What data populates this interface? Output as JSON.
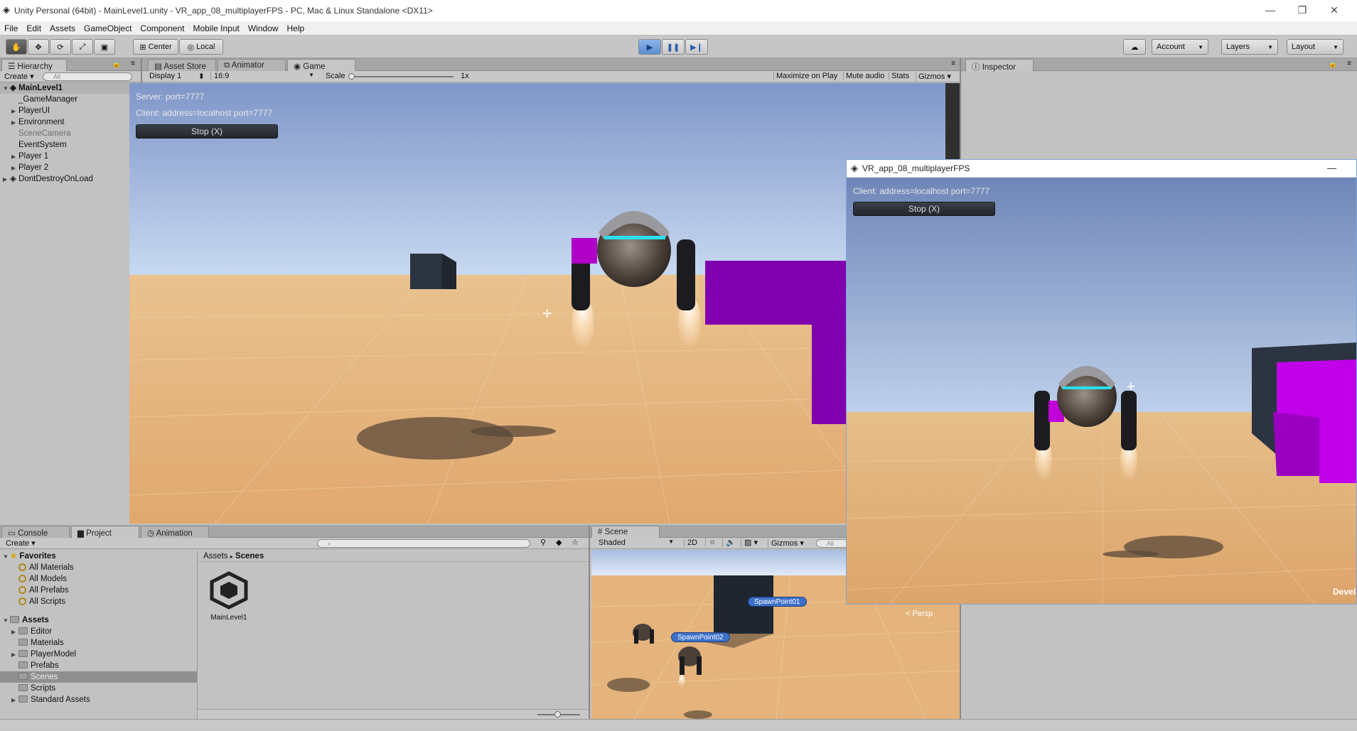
{
  "app": {
    "window_title": "Unity Personal (64bit) - MainLevel1.unity - VR_app_08_multiplayerFPS - PC, Mac & Linux Standalone <DX11>",
    "minimize": "—",
    "maximize": "❐",
    "close": "✕"
  },
  "menu": [
    "File",
    "Edit",
    "Assets",
    "GameObject",
    "Component",
    "Mobile Input",
    "Window",
    "Help"
  ],
  "toolbar": {
    "pivot": "Center",
    "space": "Local",
    "account": "Account",
    "layers": "Layers",
    "layout": "Layout"
  },
  "hierarchy": {
    "tab": "Hierarchy",
    "create": "Create",
    "search_placeholder": "All",
    "scene": "MainLevel1",
    "items": [
      {
        "label": "_GameManager",
        "expandable": false,
        "dim": false
      },
      {
        "label": "PlayerUI",
        "expandable": true,
        "dim": false
      },
      {
        "label": "Environment",
        "expandable": true,
        "dim": false
      },
      {
        "label": "SceneCamera",
        "expandable": false,
        "dim": true
      },
      {
        "label": "EventSystem",
        "expandable": false,
        "dim": false
      },
      {
        "label": "Player 1",
        "expandable": true,
        "dim": false
      },
      {
        "label": "Player 2",
        "expandable": true,
        "dim": false
      }
    ],
    "dont_destroy": "DontDestroyOnLoad"
  },
  "center_tabs": {
    "asset_store": "Asset Store",
    "animator": "Animator",
    "game": "Game"
  },
  "game_bar": {
    "display": "Display 1",
    "aspect": "16:9",
    "scale_label": "Scale",
    "scale_value": "1x",
    "maximize": "Maximize on Play",
    "mute": "Mute audio",
    "stats": "Stats",
    "gizmos": "Gizmos"
  },
  "game": {
    "server_text": "Server: port=7777",
    "client_text": "Client: address=localhost port=7777",
    "stop_button": "Stop (X)"
  },
  "inspector": {
    "tab": "Inspector"
  },
  "second_window": {
    "title": "VR_app_08_multiplayerFPS",
    "minimize": "—",
    "client_text": "Client: address=localhost port=7777",
    "stop_button": "Stop (X)",
    "watermark": "Devel"
  },
  "bottom_tabs": {
    "console": "Console",
    "project": "Project",
    "animation": "Animation"
  },
  "project": {
    "create": "Create",
    "favorites": "Favorites",
    "favorite_items": [
      "All Materials",
      "All Models",
      "All Prefabs",
      "All Scripts"
    ],
    "assets": "Assets",
    "asset_folders": [
      {
        "label": "Editor",
        "expandable": true,
        "selected": false
      },
      {
        "label": "Materials",
        "expandable": false,
        "selected": false
      },
      {
        "label": "PlayerModel",
        "expandable": true,
        "selected": false
      },
      {
        "label": "Prefabs",
        "expandable": false,
        "selected": false
      },
      {
        "label": "Scenes",
        "expandable": false,
        "selected": true
      },
      {
        "label": "Scripts",
        "expandable": false,
        "selected": false
      },
      {
        "label": "Standard Assets",
        "expandable": true,
        "selected": false
      }
    ],
    "breadcrumb_root": "Assets",
    "breadcrumb_current": "Scenes",
    "asset_name": "MainLevel1"
  },
  "scene_panel": {
    "tab": "Scene",
    "shading": "Shaded",
    "mode_2d": "2D",
    "gizmos": "Gizmos",
    "search": "All",
    "spawn1": "SpawnPoint01",
    "spawn2": "SpawnPoint02",
    "persp": "< Persp"
  },
  "colors": {
    "sky_top": "#7f96c8",
    "sky_bottom": "#c9dcf3",
    "ground": "#e2b17a",
    "purple": "#a000c8",
    "unity_blue": "#3d71c9"
  }
}
